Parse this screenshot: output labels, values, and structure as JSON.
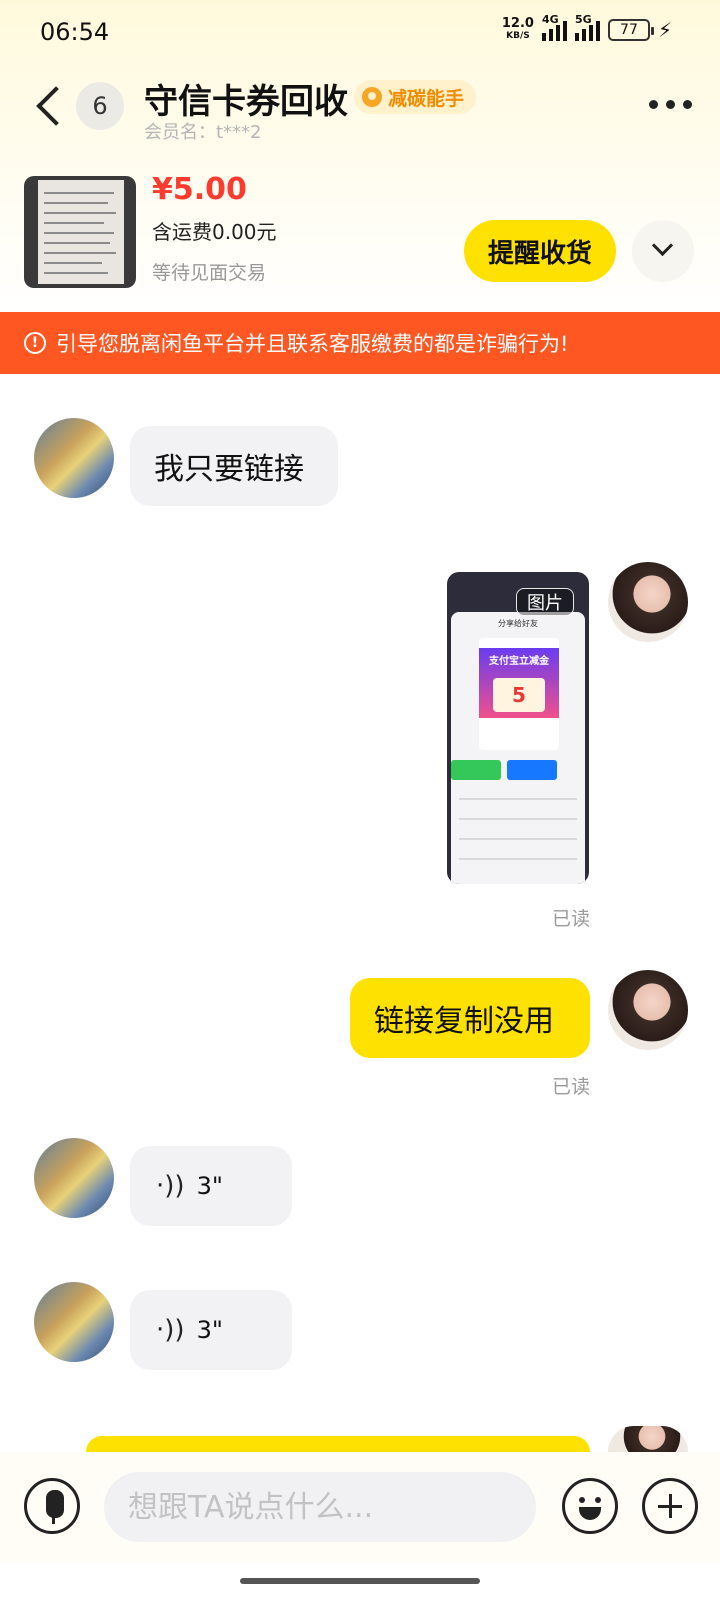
{
  "status_bar": {
    "time": "06:54",
    "net_speed_value": "12.0",
    "net_speed_unit": "KB/S",
    "sim1_label": "4G",
    "sim2_label": "5G",
    "battery": "77"
  },
  "header": {
    "unread_count": "6",
    "title": "守信卡券回收",
    "badge": "减碳能手",
    "member": "会员名：t***2"
  },
  "product": {
    "price": "¥5.00",
    "shipping": "含运费0.00元",
    "status": "等待见面交易",
    "remind_button": "提醒收货"
  },
  "warning": {
    "icon": "!",
    "text": "引导您脱离闲鱼平台并且联系客服缴费的都是诈骗行为!"
  },
  "messages": {
    "m1": {
      "text": "我只要链接"
    },
    "m2": {
      "image_tag": "图片",
      "read": "已读",
      "shot_title": "分享给好友",
      "shot_card_title": "支付宝立减金",
      "shot_amount": "5"
    },
    "m3": {
      "text": "链接复制没用",
      "read": "已读"
    },
    "m4": {
      "duration": "3\""
    },
    "m5": {
      "duration": "3\""
    }
  },
  "input": {
    "placeholder": "想跟TA说点什么..."
  }
}
